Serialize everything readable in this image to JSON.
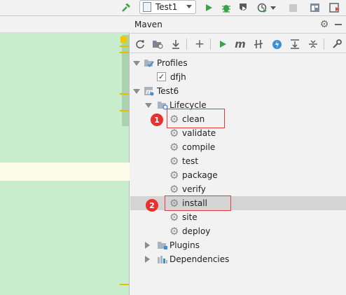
{
  "toolbar": {
    "run_config": "Test1",
    "icons": [
      "hammer-icon",
      "run-icon",
      "debug-icon",
      "coverage-icon",
      "profile-icon",
      "stop-icon",
      "project-structure-icon",
      "run-dashboard-icon"
    ]
  },
  "maven_panel": {
    "title": "Maven",
    "tree": {
      "profiles": {
        "label": "Profiles",
        "items": [
          {
            "label": "dfjh",
            "checked": true
          }
        ]
      },
      "project": {
        "label": "Test6",
        "lifecycle": {
          "label": "Lifecycle",
          "goals": [
            "clean",
            "validate",
            "compile",
            "test",
            "package",
            "verify",
            "install",
            "site",
            "deploy"
          ],
          "selected": "install"
        },
        "plugins": "Plugins",
        "dependencies": "Dependencies"
      }
    }
  },
  "annotations": [
    {
      "number": "1",
      "target": "clean"
    },
    {
      "number": "2",
      "target": "install"
    }
  ],
  "colors": {
    "editor_bg": "#c7edcc",
    "selection": "#d4d4d4",
    "annotation": "#e23b3b",
    "run_green": "#3aa34a"
  }
}
